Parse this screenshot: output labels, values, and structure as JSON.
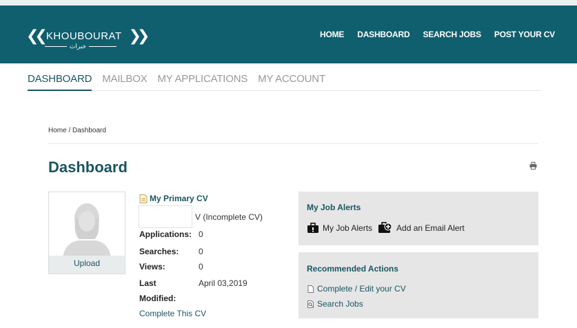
{
  "header": {
    "logo_text": "KHOUBOURAT",
    "logo_arabic": "خبرات",
    "nav": [
      "HOME",
      "DASHBOARD",
      "SEARCH JOBS",
      "POST YOUR CV"
    ]
  },
  "tabs": [
    {
      "label": "DASHBOARD",
      "active": true
    },
    {
      "label": "MAILBOX",
      "active": false
    },
    {
      "label": "MY APPLICATIONS",
      "active": false
    },
    {
      "label": "MY ACCOUNT",
      "active": false
    }
  ],
  "breadcrumb": "Home / Dashboard",
  "page_title": "Dashboard",
  "profile": {
    "upload_label": "Upload"
  },
  "cv": {
    "title": "My Primary CV",
    "status": "V (Incomplete CV)",
    "stats": [
      {
        "label": "Applications:",
        "value": "0"
      },
      {
        "label": "Searches:",
        "value": "0"
      },
      {
        "label": "Views:",
        "value": "0"
      },
      {
        "label": "Last",
        "value": "April 03,2019"
      },
      {
        "label": "Modified:",
        "value": ""
      }
    ],
    "complete_link": "Complete This CV"
  },
  "job_alerts": {
    "title": "My Job Alerts",
    "items": [
      "My Job Alerts",
      "Add an Email Alert"
    ]
  },
  "recommended": {
    "title": "Recommended Actions",
    "items": [
      "Complete / Edit your CV",
      "Search Jobs"
    ]
  },
  "colors": {
    "header_bg": "#0f5f6e",
    "accent": "#1a5562",
    "panel_bg": "#e6e6e6"
  }
}
